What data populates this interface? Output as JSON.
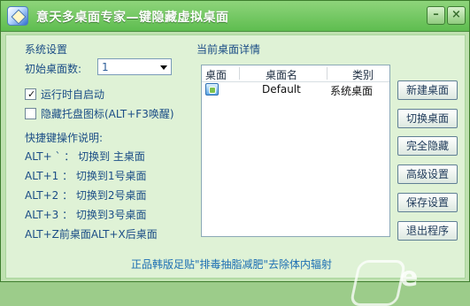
{
  "window": {
    "title": "意天多桌面专家—键隐藏虚拟桌面",
    "minimize_glyph": "–",
    "close_glyph": "×"
  },
  "left": {
    "section_title": "系统设置",
    "initial_desktop_label": "初始桌面数:",
    "initial_desktop_value": "1",
    "autostart_label": "运行时自启动",
    "autostart_checked": true,
    "hide_tray_label": "隐藏托盘图标(ALT+F3唤醒)",
    "hide_tray_checked": false,
    "shortcut_title": "快捷键操作说明:",
    "shortcuts": [
      "ALT+ ` ： 切换到 主桌面",
      "ALT+1 ： 切换到1号桌面",
      "ALT+2 ： 切换到2号桌面",
      "ALT+3 ： 切换到3号桌面",
      "ALT+Z前桌面ALT+X后桌面"
    ]
  },
  "right": {
    "section_title": "当前桌面详情",
    "columns": [
      "桌面",
      "桌面名",
      "类别"
    ],
    "rows": [
      {
        "icon": "desktop-icon",
        "name": "Default",
        "category": "系统桌面"
      }
    ],
    "buttons": [
      "新建桌面",
      "切换桌面",
      "完全隐藏",
      "高级设置",
      "保存设置",
      "退出程序"
    ]
  },
  "status": "正品韩版足贴\"排毒抽脂减肥\"去除体内辐射",
  "watermark_text": "e"
}
